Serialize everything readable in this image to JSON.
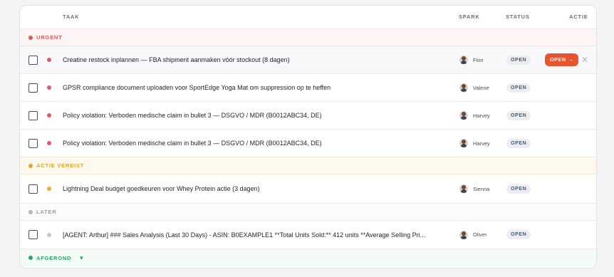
{
  "columns": {
    "taak": "TAAK",
    "spark": "SPARK",
    "status": "STATUS",
    "actie": "ACTIE"
  },
  "groups": {
    "urgent": {
      "label": "URGENT",
      "color": "#e05a5a"
    },
    "actie_vereist": {
      "label": "ACTIE VEREIST",
      "color": "#e0a52a"
    },
    "later": {
      "label": "LATER",
      "color": "#b3b5bb"
    },
    "afgerond": {
      "label": "AFGEROND",
      "color": "#2fa565",
      "caret": "▼"
    }
  },
  "rows": [
    {
      "title": "Creatine restock inplannen — FBA shipment aanmaken vóór stockout (8 dagen)",
      "assignee": "Finn",
      "status": "OPEN",
      "priority_color": "#e05a6a"
    },
    {
      "title": "GPSR compliance document uploaden voor SportEdge Yoga Mat om suppression op te heffen",
      "assignee": "Valerie",
      "status": "OPEN",
      "priority_color": "#e05a6a"
    },
    {
      "title": "Policy violation: Verboden medische claim in bullet 3 — DSGVO / MDR (B0012ABC34, DE)",
      "assignee": "Harvey",
      "status": "OPEN",
      "priority_color": "#e05a6a"
    },
    {
      "title": "Policy violation: Verboden medische claim in bullet 3 — DSGVO / MDR (B0012ABC34, DE)",
      "assignee": "Harvey",
      "status": "OPEN",
      "priority_color": "#e05a6a"
    },
    {
      "title": "Lightning Deal budget goedkeuren voor Whey Protein actie (3 dagen)",
      "assignee": "Sienna",
      "status": "OPEN",
      "priority_color": "#e8b02e"
    },
    {
      "title": "[AGENT: Arthur] ### Sales Analysis (Last 30 Days) - ASIN: B0EXAMPLE1 **Total Units Sold:** 412 units **Average Selling Pri...",
      "assignee": "Oliver",
      "status": "OPEN",
      "priority_color": "#c5c8ce"
    }
  ],
  "actions": {
    "open_button": "OPEN →",
    "close_icon": "✕"
  }
}
